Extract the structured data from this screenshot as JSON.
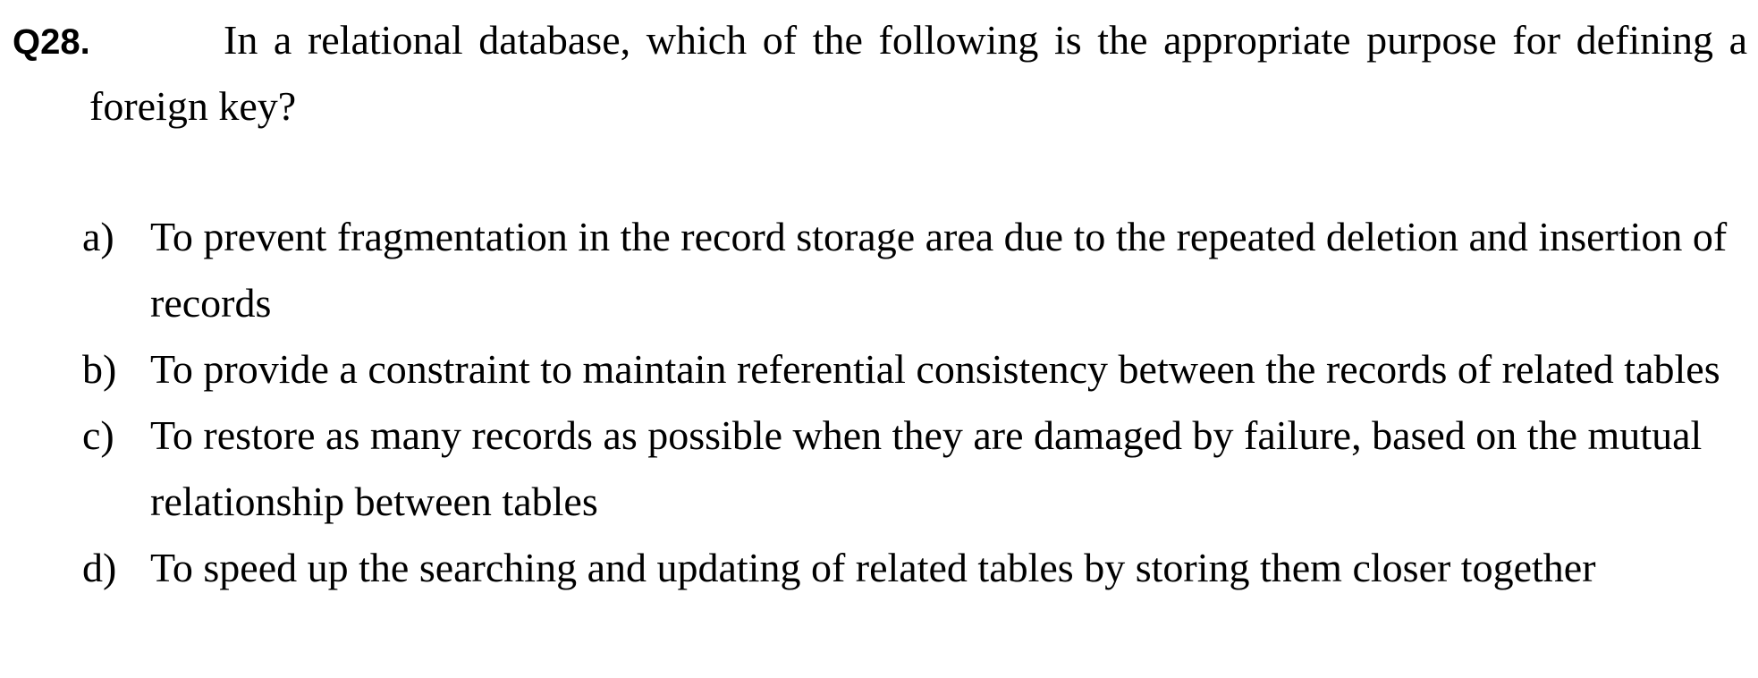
{
  "question": {
    "number": "Q28.",
    "text": "In a relational database, which of the following is the appropriate purpose for defining a foreign key?"
  },
  "options": [
    {
      "letter": "a)",
      "text": "To prevent fragmentation in the record storage area due to the repeated deletion and insertion of records"
    },
    {
      "letter": "b)",
      "text": "To provide a constraint to maintain referential consistency between the records of related tables"
    },
    {
      "letter": "c)",
      "text": "To restore as many records as possible when they are damaged by failure, based on the mutual relationship between tables"
    },
    {
      "letter": "d)",
      "text": "To speed up the searching and updating of related tables by storing them closer together"
    }
  ]
}
